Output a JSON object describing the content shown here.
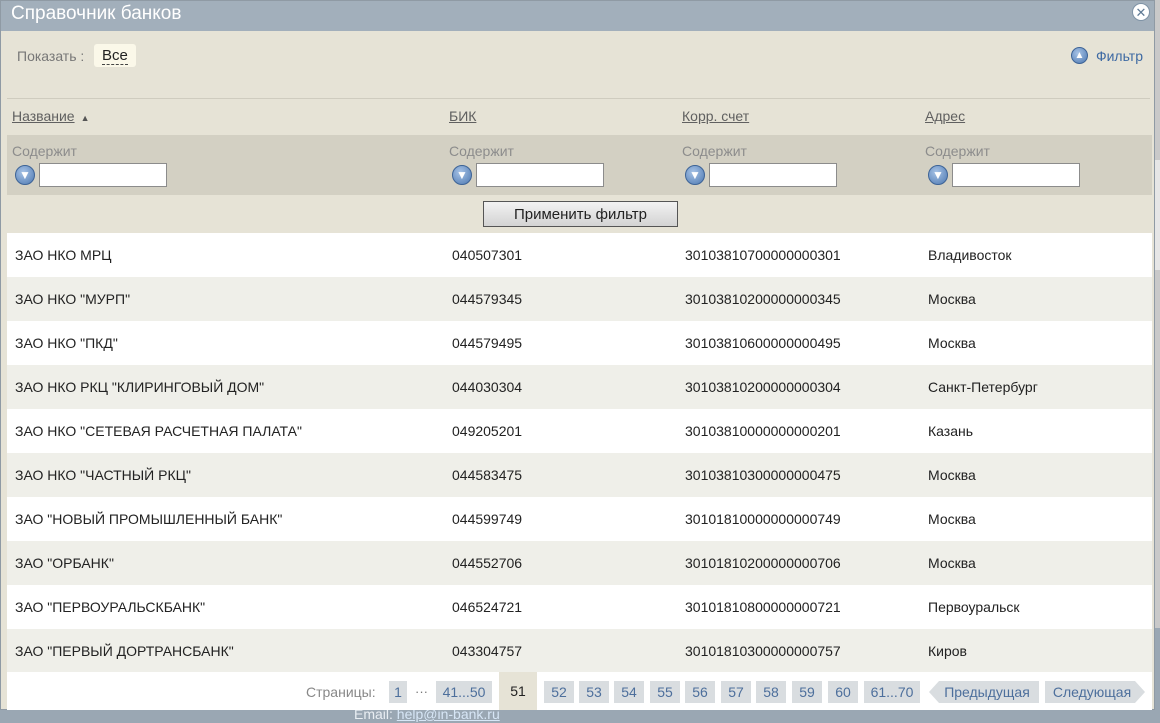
{
  "dialog": {
    "title": "Справочник банков",
    "close_icon": "close-icon"
  },
  "show": {
    "label": "Показать :",
    "value": "Все"
  },
  "filter_toggle": {
    "label": "Фильтр",
    "icon": "chevron-up-circle-icon"
  },
  "columns": [
    {
      "label": "Название",
      "sorted": "ascending"
    },
    {
      "label": "БИК"
    },
    {
      "label": "Корр. счет"
    },
    {
      "label": "Адрес"
    }
  ],
  "filters": [
    {
      "label": "Содержит",
      "value": ""
    },
    {
      "label": "Содержит",
      "value": ""
    },
    {
      "label": "Содержит",
      "value": ""
    },
    {
      "label": "Содержит",
      "value": ""
    }
  ],
  "apply_button": "Применить фильтр",
  "rows": [
    {
      "name": "ЗАО НКО МРЦ",
      "bik": "040507301",
      "account": "30103810700000000301",
      "address": "Владивосток"
    },
    {
      "name": "ЗАО НКО \"МУРП\"",
      "bik": "044579345",
      "account": "30103810200000000345",
      "address": "Москва"
    },
    {
      "name": "ЗАО НКО \"ПКД\"",
      "bik": "044579495",
      "account": "30103810600000000495",
      "address": "Москва"
    },
    {
      "name": "ЗАО НКО РКЦ \"КЛИРИНГОВЫЙ ДОМ\"",
      "bik": "044030304",
      "account": "30103810200000000304",
      "address": "Санкт-Петербург"
    },
    {
      "name": "ЗАО НКО \"СЕТЕВАЯ РАСЧЕТНАЯ ПАЛАТА\"",
      "bik": "049205201",
      "account": "30103810000000000201",
      "address": "Казань"
    },
    {
      "name": "ЗАО НКО \"ЧАСТНЫЙ РКЦ\"",
      "bik": "044583475",
      "account": "30103810300000000475",
      "address": "Москва"
    },
    {
      "name": "ЗАО \"НОВЫЙ ПРОМЫШЛЕННЫЙ БАНК\"",
      "bik": "044599749",
      "account": "30101810000000000749",
      "address": "Москва"
    },
    {
      "name": "ЗАО \"ОРБАНК\"",
      "bik": "044552706",
      "account": "30101810200000000706",
      "address": "Москва"
    },
    {
      "name": "ЗАО \"ПЕРВОУРАЛЬСКБАНК\"",
      "bik": "046524721",
      "account": "30101810800000000721",
      "address": "Первоуральск"
    },
    {
      "name": "ЗАО \"ПЕРВЫЙ ДОРТРАНСБАНК\"",
      "bik": "043304757",
      "account": "30101810300000000757",
      "address": "Киров"
    }
  ],
  "pager": {
    "label": "Страницы:",
    "first": "1",
    "ellipsis": "···",
    "range_prev": "41...50",
    "current": "51",
    "pages": [
      "52",
      "53",
      "54",
      "55",
      "56",
      "57",
      "58",
      "59",
      "60"
    ],
    "range_next": "61...70",
    "prev": "Предыдущая",
    "next": "Следующая"
  },
  "background": {
    "email_label": "Email:",
    "email_link": "help@in-bank.ru"
  },
  "colors": {
    "titlebar": "#a2afbb",
    "panel": "#e6e3d6",
    "filter_row": "#d3d0c3",
    "link": "#3e6aa3"
  }
}
